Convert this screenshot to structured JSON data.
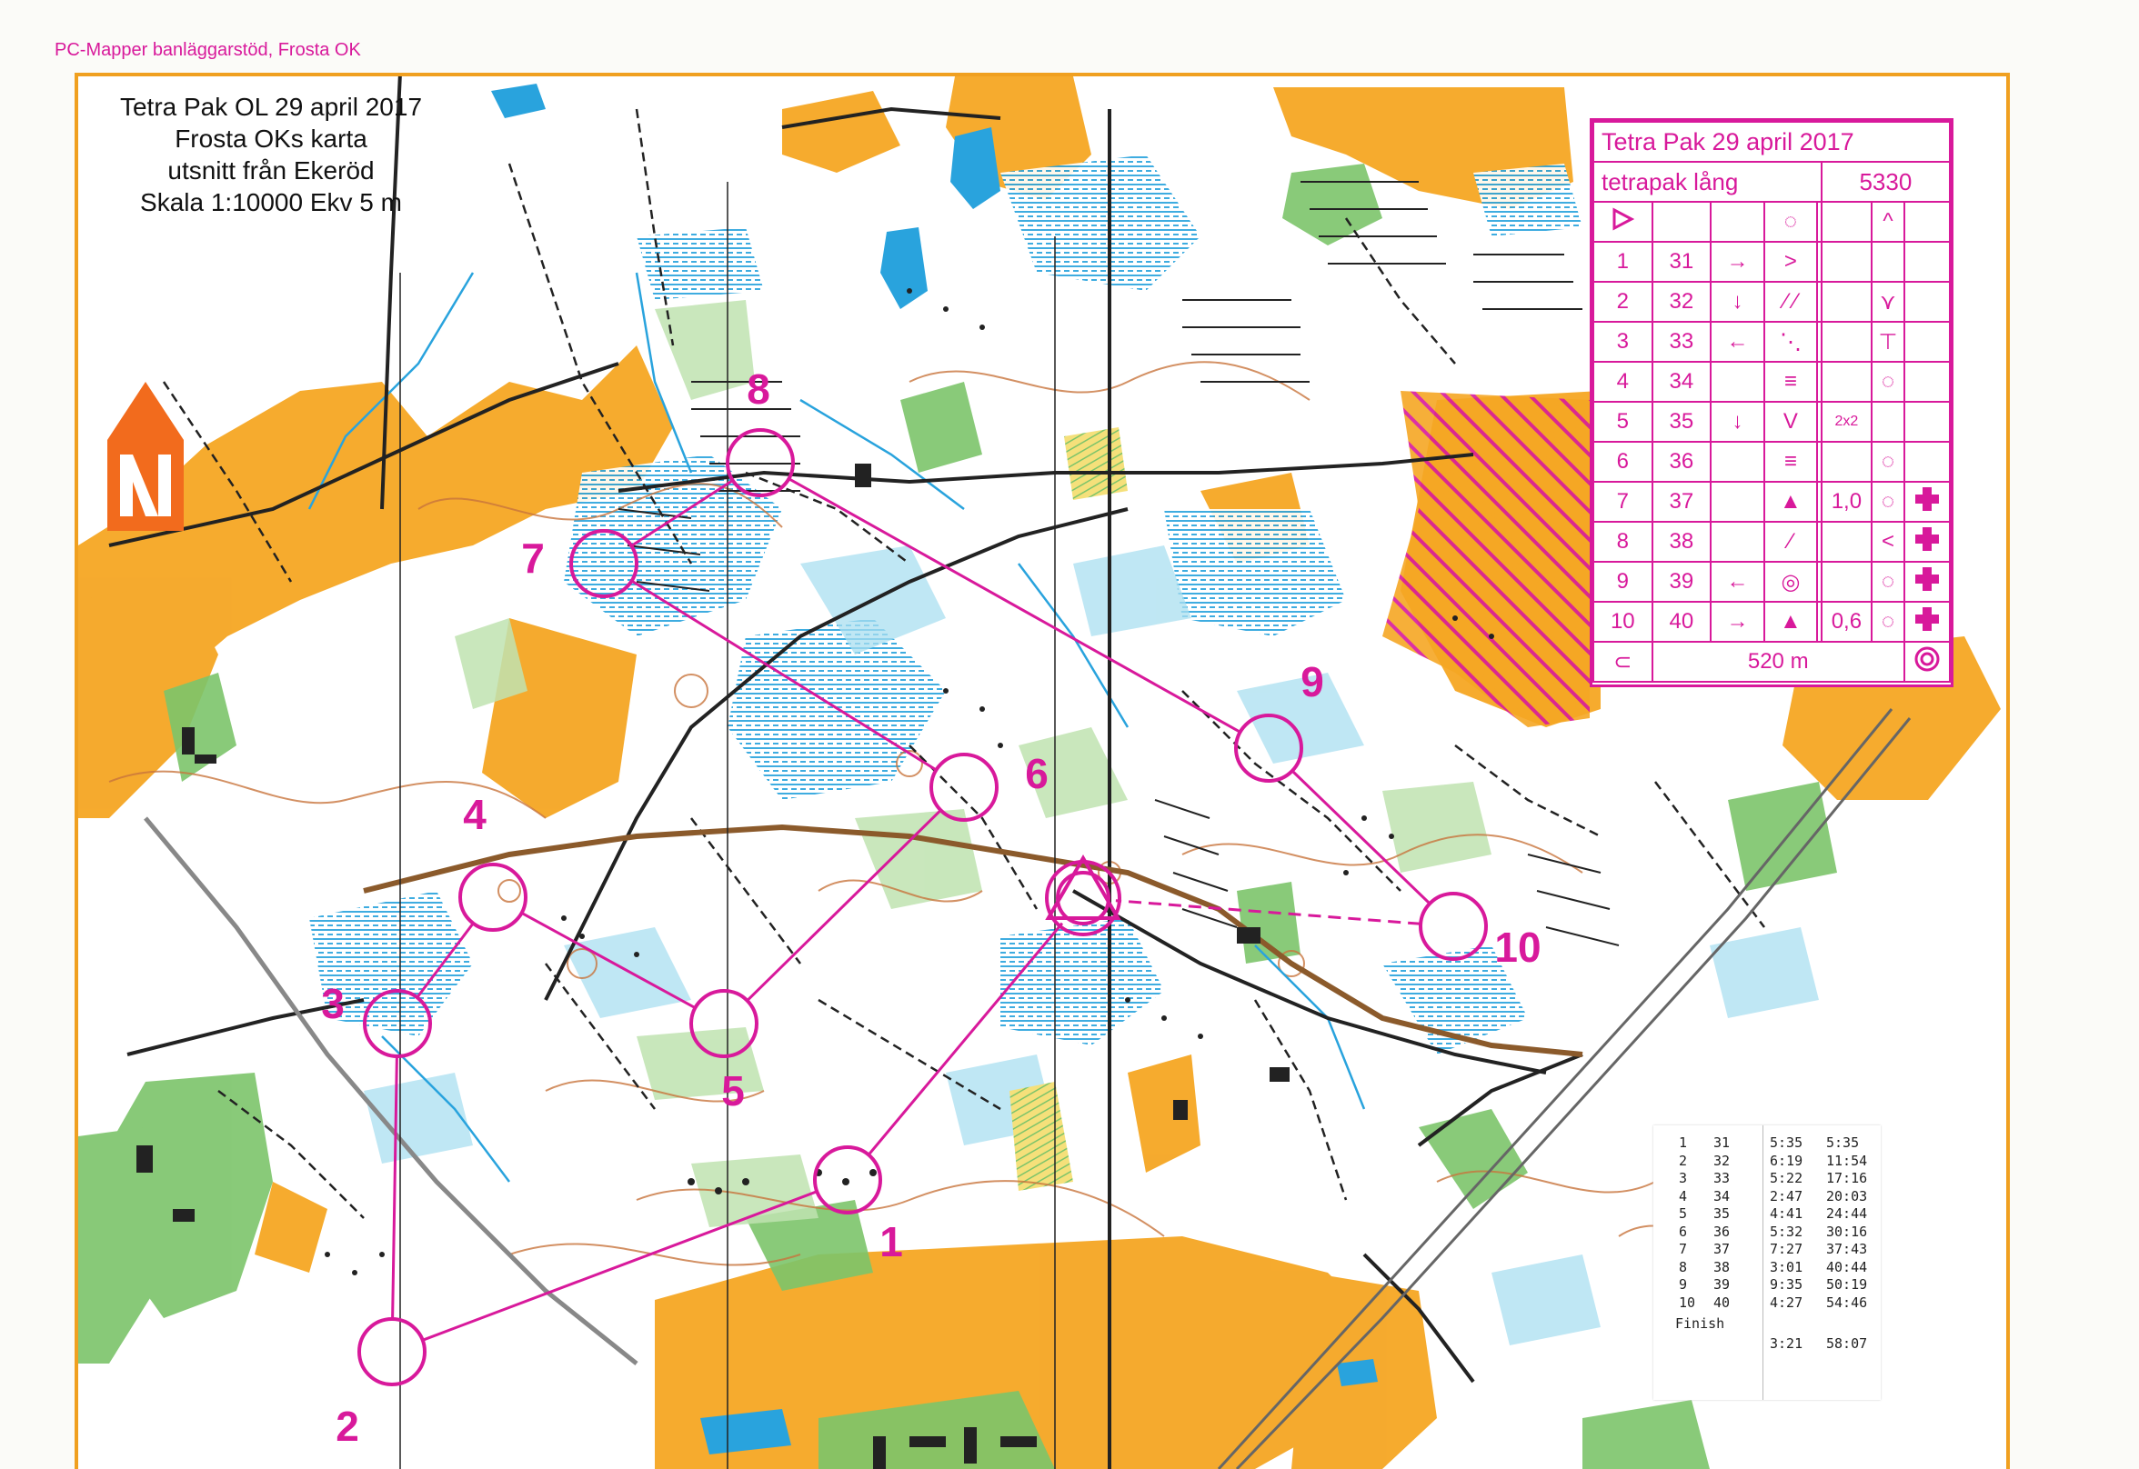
{
  "header_note": "PC-Mapper banläggarstöd, Frosta OK",
  "map_title": {
    "line1": "Tetra Pak OL 29 april 2017",
    "line2": "Frosta OKs karta",
    "line3": "utsnitt från Ekeröd",
    "line4": "Skala 1:10000 Ekv 5 m"
  },
  "control_labels": [
    "1",
    "2",
    "3",
    "4",
    "5",
    "6",
    "7",
    "8",
    "9",
    "10"
  ],
  "description_sheet": {
    "event": "Tetra Pak 29 april 2017",
    "course": "tetrapak lång",
    "course_code": "5330",
    "rows": [
      {
        "num": "1",
        "code": "31",
        "dir": "→",
        "note": ""
      },
      {
        "num": "2",
        "code": "32",
        "dir": "↓",
        "note": ""
      },
      {
        "num": "3",
        "code": "33",
        "dir": "←",
        "note": ""
      },
      {
        "num": "4",
        "code": "34",
        "dir": "",
        "note": ""
      },
      {
        "num": "5",
        "code": "35",
        "dir": "↓",
        "note": "2x2"
      },
      {
        "num": "6",
        "code": "36",
        "dir": "",
        "note": ""
      },
      {
        "num": "7",
        "code": "37",
        "dir": "",
        "note": "1,0"
      },
      {
        "num": "8",
        "code": "38",
        "dir": "",
        "note": ""
      },
      {
        "num": "9",
        "code": "39",
        "dir": "←",
        "note": ""
      },
      {
        "num": "10",
        "code": "40",
        "dir": "→",
        "note": "0,6"
      }
    ],
    "finish_distance": "520 m"
  },
  "split_receipt": {
    "rows": [
      {
        "n": "1",
        "code": "31",
        "split": "5:35",
        "total": "5:35"
      },
      {
        "n": "2",
        "code": "32",
        "split": "6:19",
        "total": "11:54"
      },
      {
        "n": "3",
        "code": "33",
        "split": "5:22",
        "total": "17:16"
      },
      {
        "n": "4",
        "code": "34",
        "split": "2:47",
        "total": "20:03"
      },
      {
        "n": "5",
        "code": "35",
        "split": "4:41",
        "total": "24:44"
      },
      {
        "n": "6",
        "code": "36",
        "split": "5:32",
        "total": "30:16"
      },
      {
        "n": "7",
        "code": "37",
        "split": "7:27",
        "total": "37:43"
      },
      {
        "n": "8",
        "code": "38",
        "split": "3:01",
        "total": "40:44"
      },
      {
        "n": "9",
        "code": "39",
        "split": "9:35",
        "total": "50:19"
      },
      {
        "n": "10",
        "code": "40",
        "split": "4:27",
        "total": "54:46"
      }
    ],
    "finish_label": "Finish",
    "finish_split": "3:21",
    "finish_total": "58:07"
  },
  "colors": {
    "course_magenta": "#d8199b",
    "open_land": "#f5a623",
    "forest_green": "#7cc46a",
    "marsh_blue": "#29a3dd",
    "road_black": "#222222",
    "contour_brown": "#c8743c",
    "page_border": "#f0a020"
  },
  "icons": {
    "north_arrow": "north-arrow-icon",
    "start": "start-triangle-icon",
    "finish": "finish-double-circle-icon",
    "first_aid": "first-aid-cross-icon"
  }
}
